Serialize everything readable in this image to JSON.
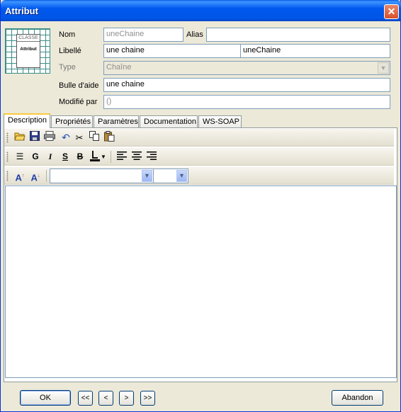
{
  "window": {
    "title": "Attribut",
    "close_glyph": "✕"
  },
  "header": {
    "icon": {
      "name": "class-attribute-icon",
      "class_label": "CLASSE",
      "attribute_label": "Attribut"
    },
    "nom_label": "Nom",
    "nom_value": "uneChaine",
    "alias_label": "Alias",
    "alias_value": "",
    "libelle_label": "Libellé",
    "libelle_value": "une chaine",
    "libelle_value2": "uneChaine",
    "type_label": "Type",
    "type_value": "Chaîne",
    "bulle_label": "Bulle d'aide",
    "bulle_value": "une chaine",
    "modifie_label": "Modifié par",
    "modifie_value": "()"
  },
  "tabs": [
    {
      "label": "Description",
      "active": true
    },
    {
      "label": "Propriétés",
      "active": false
    },
    {
      "label": "Paramètres",
      "active": false
    },
    {
      "label": "Documentation",
      "active": false
    },
    {
      "label": "WS-SOAP",
      "active": false
    }
  ],
  "toolbar": {
    "row1_icons": [
      "open-folder-icon",
      "save-icon",
      "print-icon",
      "undo-icon",
      "cut-icon",
      "copy-icon",
      "paste-icon"
    ],
    "row2": {
      "bold": "G",
      "italic": "I",
      "underline": "S",
      "strike": "B",
      "bullets_icon": "bullet-list-icon",
      "color_icon": "font-color-icon"
    },
    "row3": {
      "grow_font": "A",
      "shrink_font": "A",
      "font_value": "",
      "size_value": ""
    }
  },
  "editor": {
    "content": ""
  },
  "footer": {
    "ok_label": "OK",
    "first_label": "<<",
    "prev_label": "<",
    "next_label": ">",
    "last_label": ">>",
    "cancel_label": "Abandon"
  },
  "colors": {
    "titlebar": "#0058EE",
    "active_tab_accent": "#FFC83C",
    "frame": "#ECE9D8"
  }
}
